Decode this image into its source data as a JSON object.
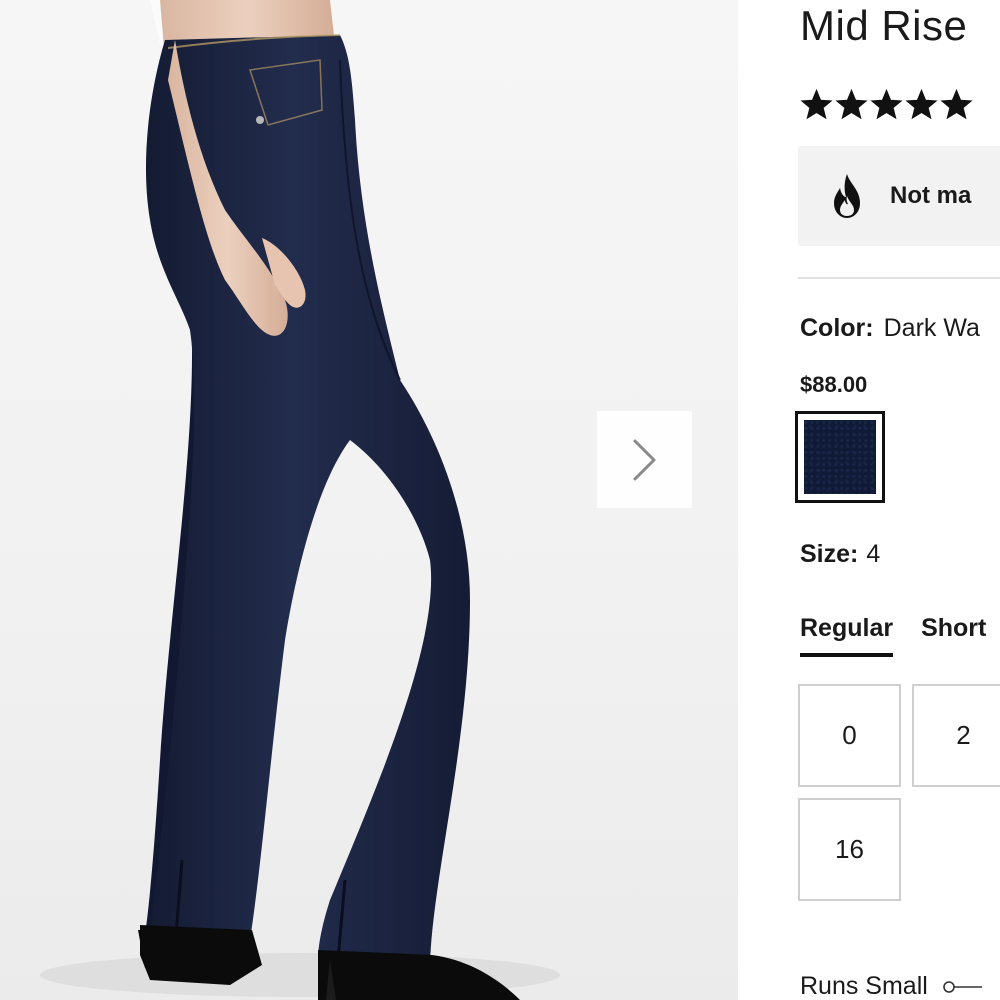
{
  "product": {
    "title": "Mid Rise",
    "rating": 5,
    "rating_max": 5,
    "promo_text": "Not ma",
    "color_label": "Color:",
    "color_value": "Dark Wa",
    "price": "$88.00",
    "swatch_color": "#0e1a36",
    "size_label": "Size:",
    "size_value": "4"
  },
  "fit_tabs": [
    {
      "label": "Regular",
      "active": true
    },
    {
      "label": "Short",
      "active": false
    }
  ],
  "sizes": [
    "0",
    "2",
    "16"
  ],
  "fit_feedback": {
    "label": "Runs Small"
  },
  "gallery": {
    "next_icon": "chevron-right-icon"
  },
  "colors": {
    "denim": "#1b2440",
    "text": "#1a1a1a",
    "promo_bg": "#f2f2f2"
  }
}
